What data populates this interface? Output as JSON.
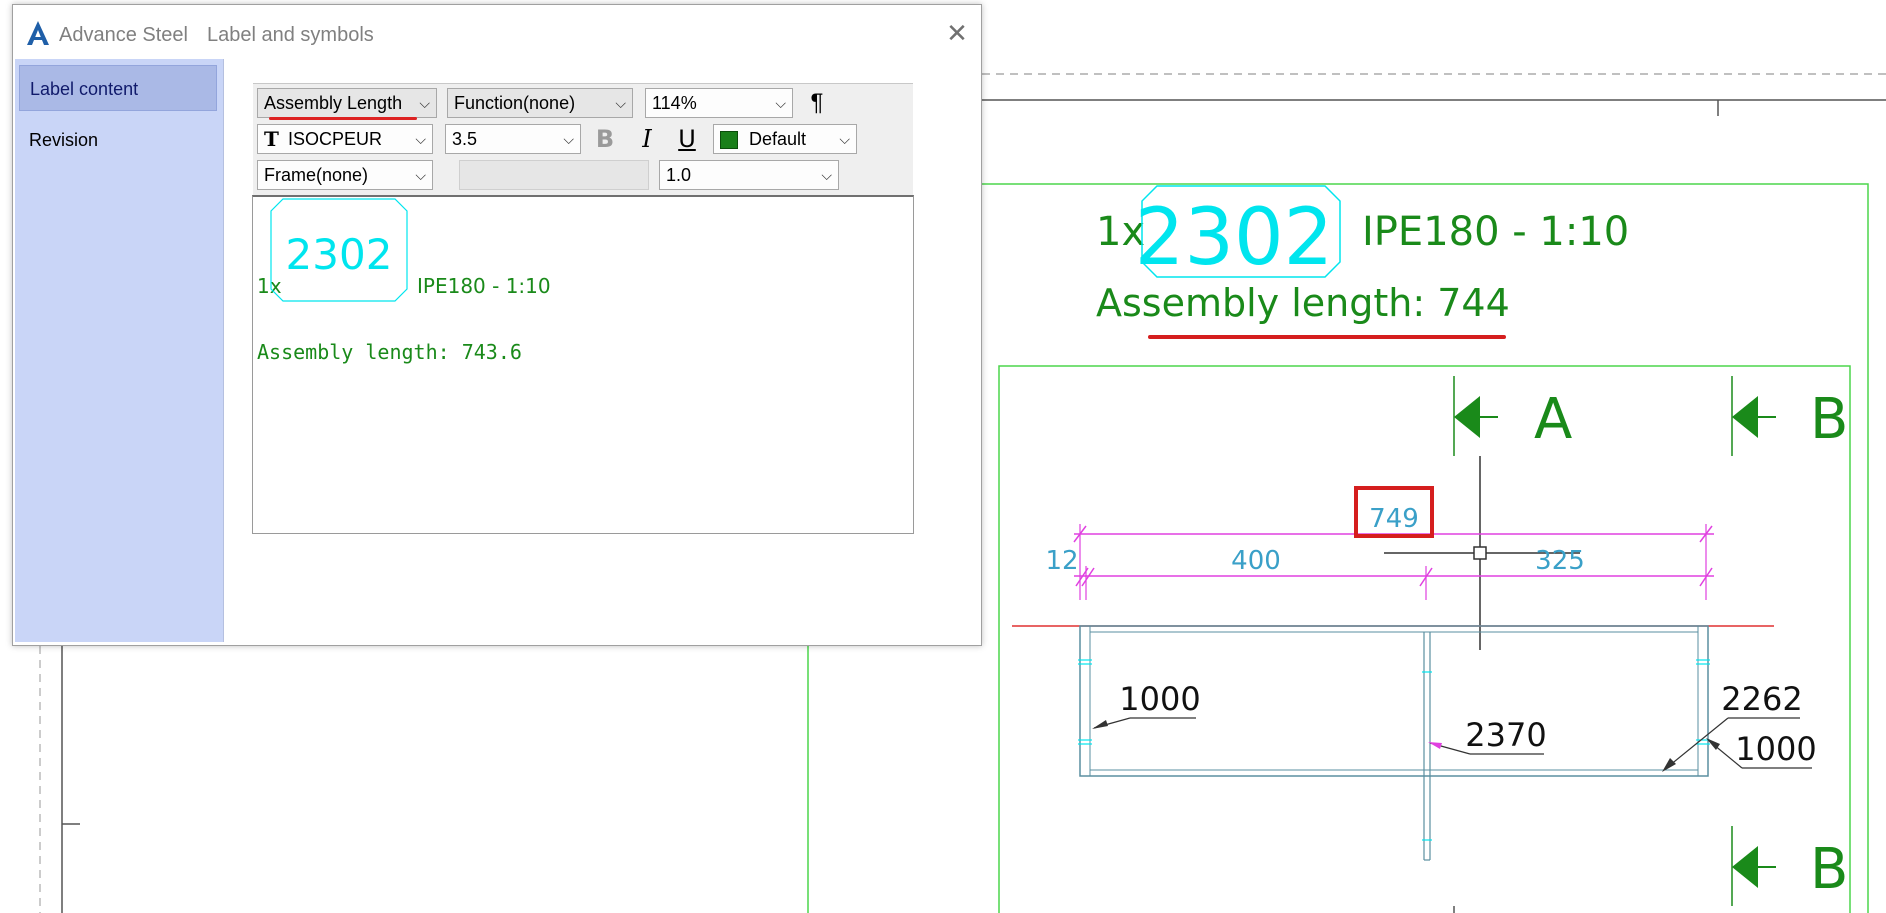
{
  "dialog": {
    "app_name": "Advance Steel",
    "title": "Label and symbols",
    "close_icon": "close-icon",
    "sidebar": {
      "items": [
        {
          "label": "Label content",
          "active": true
        },
        {
          "label": "Revision",
          "active": false
        }
      ]
    },
    "toolbar": {
      "field_combo": "Assembly Length",
      "function_combo": "Function(none)",
      "zoom_combo": "114%",
      "paragraph_icon": "¶",
      "font_combo": "ISOCPEUR",
      "font_icon": "truetype-font-icon",
      "size_combo": "3.5",
      "bold_label": "B",
      "italic_label": "I",
      "underline_label": "U",
      "color_combo": "Default",
      "color_swatch": "#1a7f1a",
      "frame_combo": "Frame(none)",
      "scale_combo": "1.0"
    },
    "editor": {
      "count": "1x",
      "mark": "2302",
      "profile": "IPE180  -  1:10",
      "assembly_line": "Assembly length: 743.6"
    }
  },
  "drawing": {
    "header_count": "1x",
    "header_mark": "2302",
    "header_profile": "IPE180  -  1:10",
    "assembly_length": "Assembly length: 744",
    "section_a": "A",
    "section_b_top": "B",
    "section_b_bottom": "B",
    "dim_total": "749",
    "dim_12": "12",
    "dim_400": "400",
    "dim_325": "325",
    "label_1000_left": "1000",
    "label_2370": "2370",
    "label_2262": "2262",
    "label_1000_right": "1000"
  },
  "colors": {
    "green": "#1a8a1a",
    "light_green": "#4cd64c",
    "cyan": "#00e5ee",
    "magenta": "#e040e0",
    "dim_text": "#3aa0c8",
    "highlight_red": "#d51e1e"
  }
}
